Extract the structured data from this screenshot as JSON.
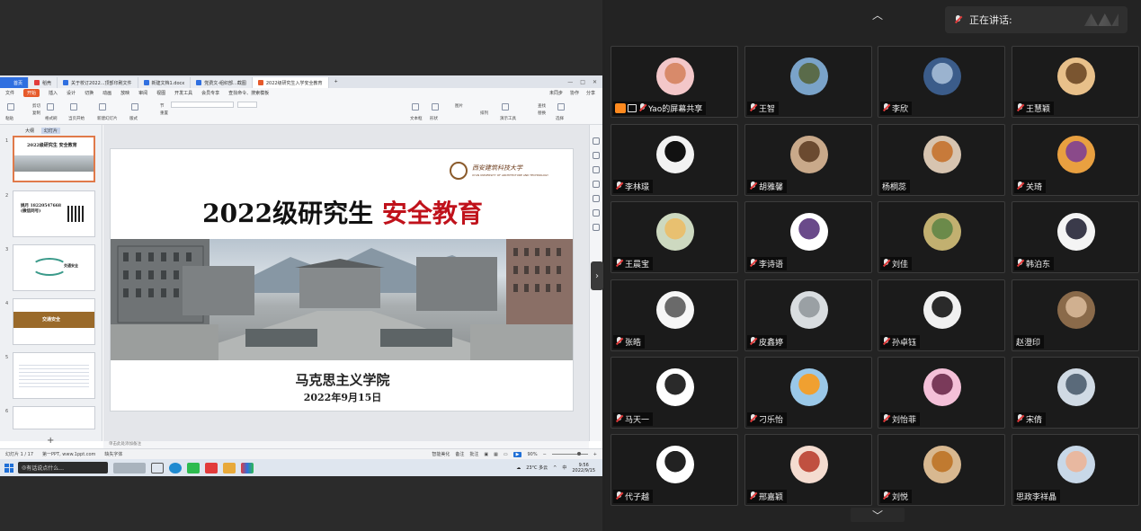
{
  "wps": {
    "tabs": [
      {
        "label": "首页",
        "color": "#2f6fe0"
      },
      {
        "label": "稻壳",
        "color": "#e23b3b"
      },
      {
        "label": "关于校订2022...顶部印刷文件",
        "color": "#2f6fe0"
      },
      {
        "label": "新建文档1.docx",
        "color": "#2f6fe0"
      },
      {
        "label": "党费文-组织部...截图",
        "color": "#2f6fe0"
      },
      {
        "label": "2022级研究生入学安全教育",
        "color": "#e65a2b"
      }
    ],
    "menu": [
      "文件",
      "开始",
      "插入",
      "设计",
      "切换",
      "动画",
      "放映",
      "审阅",
      "视图",
      "开发工具",
      "会员专享",
      "查找命令、搜索模板"
    ],
    "menu_right": [
      "未同步",
      "协作",
      "分享"
    ],
    "ribbon_labels": [
      "粘贴",
      "剪切",
      "复制",
      "格式刷",
      "当页开始",
      "新建幻灯片",
      "版式",
      "节",
      "重置",
      "文本框",
      "形状",
      "图片",
      "排列",
      "演示工具",
      "查找",
      "替换",
      "选择"
    ],
    "pane_tabs": [
      "大纲",
      "幻灯片"
    ],
    "slide_count": "17",
    "thumbs": [
      {
        "num": "1",
        "title": "2022级研究生 安全教育"
      },
      {
        "num": "2",
        "title": "姚月 18220547668 (微信同号)"
      },
      {
        "num": "3",
        "title": "交通安全"
      },
      {
        "num": "4",
        "title": "交通安全"
      },
      {
        "num": "5",
        "title": ""
      },
      {
        "num": "6",
        "title": ""
      }
    ],
    "slide": {
      "logo_text": "西安建筑科技大学",
      "logo_sub": "XI'AN UNIVERSITY OF ARCHITECTURE AND TECHNOLOGY",
      "title_black": "2022级研究生",
      "title_red": "安全教育",
      "org": "马克思主义学院",
      "date": "2022年9月15日"
    },
    "notes_placeholder": "单击此处添加备注",
    "status_left": "幻灯片 1 / 17",
    "status_theme": "第一PPT, www.1ppt.com",
    "status_font": "缺失字体",
    "status_zoom": "90%",
    "status_smart": "智能美化",
    "status_notes": "备注",
    "status_comment": "批注"
  },
  "taskbar": {
    "search_text": "有话说点什么...",
    "weather": "23°C 多云",
    "ime": "中",
    "time": "9:56",
    "date": "2022/9/15"
  },
  "meeting": {
    "speaking_label": "正在讲话:",
    "participants": [
      {
        "name": "Yao的屏幕共享",
        "share": true,
        "avatar_bg": "#f3c7c9",
        "avatar_fg": "#d88a6a"
      },
      {
        "name": "王智",
        "avatar_bg": "#7aa3c9",
        "avatar_fg": "#5a6b4a"
      },
      {
        "name": "李欣",
        "avatar_bg": "#3b5c8a",
        "avatar_fg": "#9bb3cf"
      },
      {
        "name": "王慧颖",
        "avatar_bg": "#e8c08a",
        "avatar_fg": "#7a5530"
      },
      {
        "name": "李林璟",
        "avatar_bg": "#f2f2f2",
        "avatar_fg": "#111111"
      },
      {
        "name": "胡雅馨",
        "avatar_bg": "#c9a98a",
        "avatar_fg": "#6b4a30"
      },
      {
        "name": "杨桐蕊",
        "muted": false,
        "avatar_bg": "#d7c4b0",
        "avatar_fg": "#c77a3a"
      },
      {
        "name": "关琦",
        "avatar_bg": "#e9a040",
        "avatar_fg": "#8a4a8a"
      },
      {
        "name": "王晨宝",
        "avatar_bg": "#cdd9c0",
        "avatar_fg": "#e8c070"
      },
      {
        "name": "李诗语",
        "avatar_bg": "#ffffff",
        "avatar_fg": "#6a4a8a"
      },
      {
        "name": "刘佳",
        "avatar_bg": "#c2b070",
        "avatar_fg": "#6b8a4a"
      },
      {
        "name": "韩泊东",
        "avatar_bg": "#f4f4f4",
        "avatar_fg": "#3a3a4a"
      },
      {
        "name": "张皓",
        "avatar_bg": "#f6f6f6",
        "avatar_fg": "#6a6a6a"
      },
      {
        "name": "皮鑫婷",
        "avatar_bg": "#d9dde0",
        "avatar_fg": "#9aa0a4"
      },
      {
        "name": "孙卓钰",
        "avatar_bg": "#f0f0f0",
        "avatar_fg": "#2a2a2a"
      },
      {
        "name": "赵澄印",
        "muted": false,
        "avatar_bg": "#8a6a4a",
        "avatar_fg": "#d0b090"
      },
      {
        "name": "马天一",
        "avatar_bg": "#ffffff",
        "avatar_fg": "#2a2a2a"
      },
      {
        "name": "刁乐怡",
        "avatar_bg": "#9ac8e8",
        "avatar_fg": "#f0a030"
      },
      {
        "name": "刘怡菲",
        "avatar_bg": "#f4c0d8",
        "avatar_fg": "#7a3a5a"
      },
      {
        "name": "宋倩",
        "avatar_bg": "#d0dae4",
        "avatar_fg": "#5a6a7a"
      },
      {
        "name": "代子越",
        "avatar_bg": "#ffffff",
        "avatar_fg": "#222222"
      },
      {
        "name": "邢嘉颖",
        "avatar_bg": "#f4dcd0",
        "avatar_fg": "#c05040"
      },
      {
        "name": "刘悦",
        "avatar_bg": "#d8b890",
        "avatar_fg": "#c07a30"
      },
      {
        "name": "思政李祥晶",
        "muted": false,
        "avatar_bg": "#c8d8e8",
        "avatar_fg": "#e8b8a0"
      }
    ]
  }
}
